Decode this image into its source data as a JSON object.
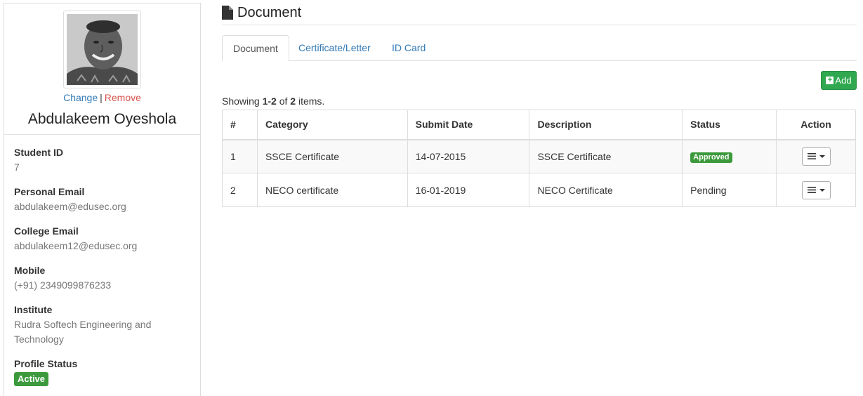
{
  "profile": {
    "change_label": "Change",
    "separator": "|",
    "remove_label": "Remove",
    "name": "Abdulakeem Oyeshola",
    "fields": [
      {
        "label": "Student ID",
        "value": "7"
      },
      {
        "label": "Personal Email",
        "value": "abdulakeem@edusec.org"
      },
      {
        "label": "College Email",
        "value": "abdulakeem12@edusec.org"
      },
      {
        "label": "Mobile",
        "value": "(+91) 2349099876233"
      },
      {
        "label": "Institute",
        "value": "Rudra Softech Engineering and Technology"
      }
    ],
    "status_label": "Profile Status",
    "status_value": "Active"
  },
  "page": {
    "title": "Document",
    "tabs": [
      {
        "label": "Document",
        "active": true
      },
      {
        "label": "Certificate/Letter",
        "active": false
      },
      {
        "label": "ID Card",
        "active": false
      }
    ],
    "add_label": "Add"
  },
  "summary": {
    "prefix": "Showing ",
    "range": "1-2",
    "mid": " of ",
    "total": "2",
    "suffix": " items."
  },
  "table": {
    "headers": {
      "num": "#",
      "category": "Category",
      "submit_date": "Submit Date",
      "description": "Description",
      "status": "Status",
      "action": "Action"
    },
    "rows": [
      {
        "num": "1",
        "category": "SSCE Certificate",
        "submit_date": "14-07-2015",
        "description": "SSCE Certificate",
        "status": "Approved"
      },
      {
        "num": "2",
        "category": "NECO certificate",
        "submit_date": "16-01-2019",
        "description": "NECO Certificate",
        "status": "Pending"
      }
    ]
  },
  "icons": {
    "page_icon": "file-icon",
    "add_icon": "plus-square-icon",
    "action_icon": "list-menu-icon"
  },
  "colors": {
    "link": "#337ab7",
    "remove": "#d9534f",
    "success": "#2fa84f",
    "badge": "#3c9a3c"
  }
}
